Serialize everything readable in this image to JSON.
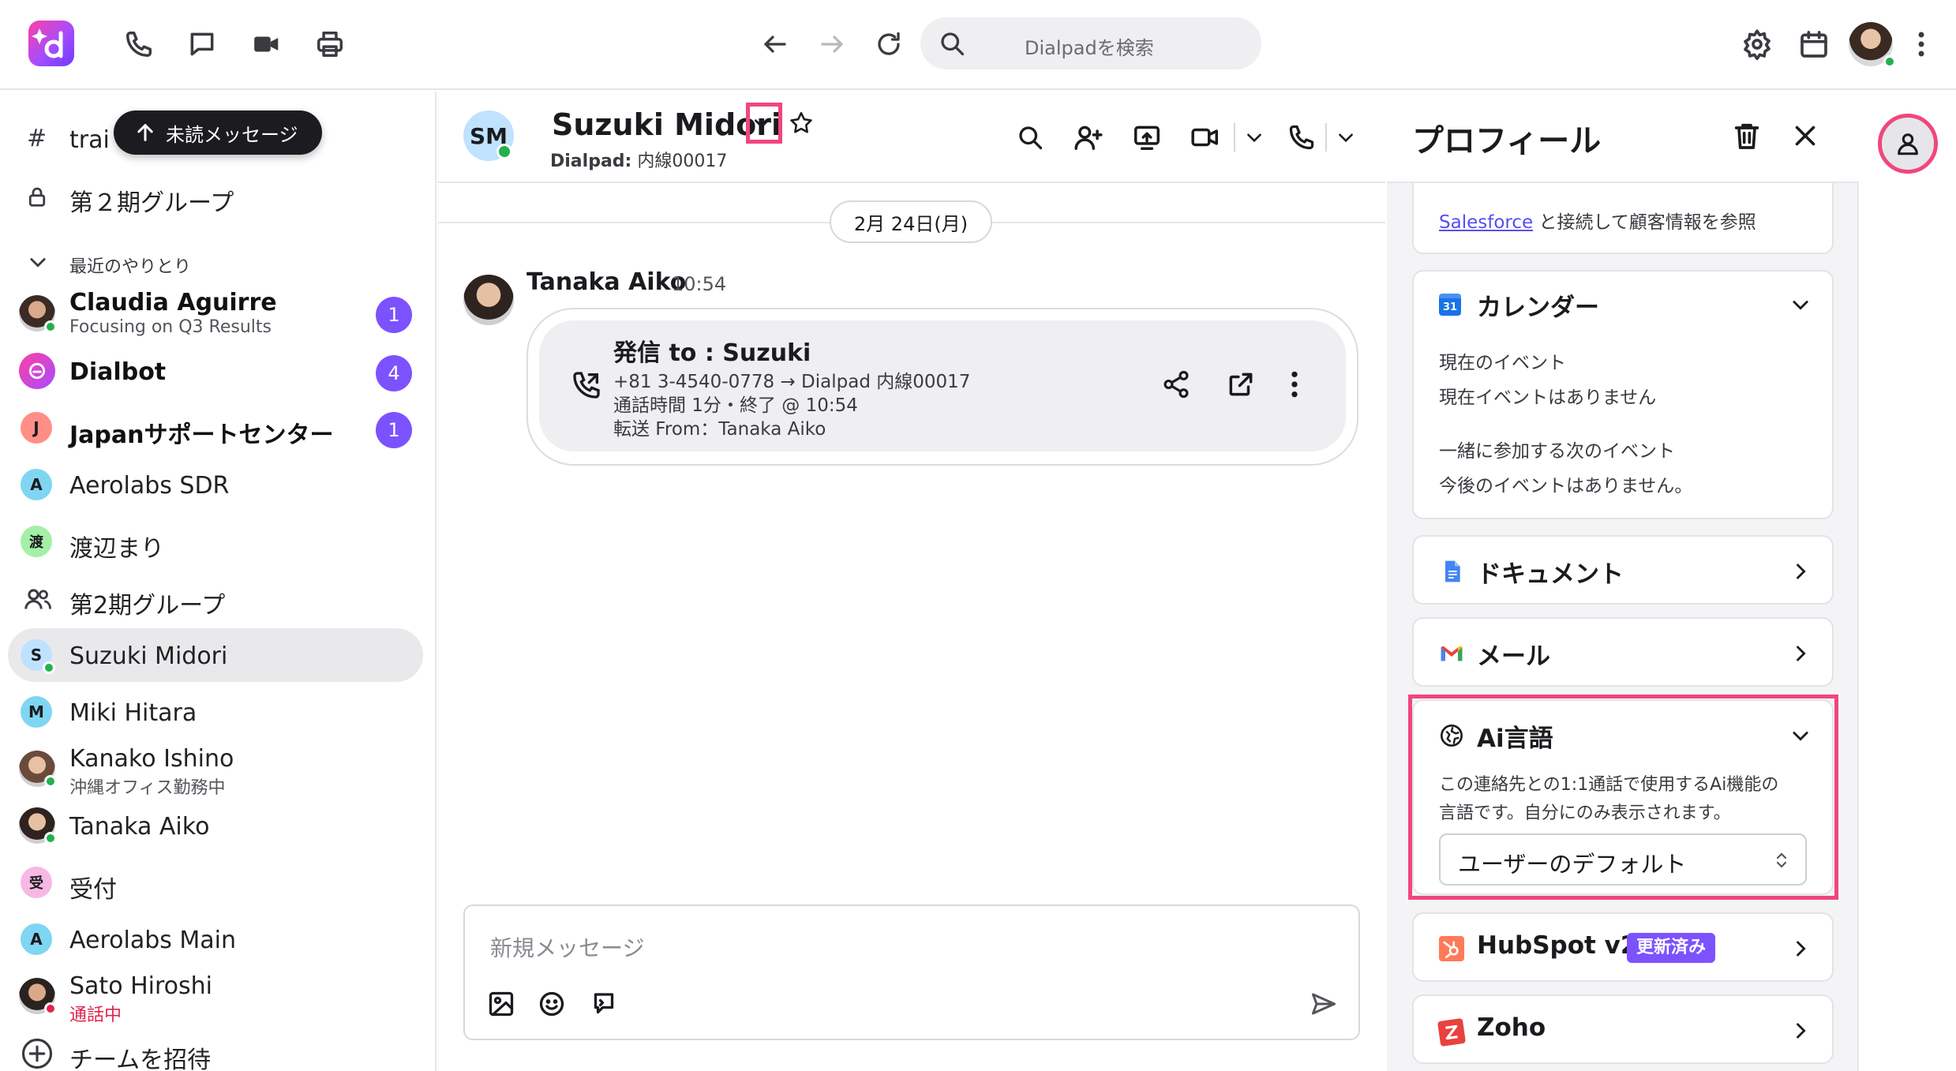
{
  "topbar": {
    "search_placeholder": "Dialpadを検索",
    "avatar_status": "online"
  },
  "sidebar": {
    "unread_pill": "未読メッセージ",
    "partial_row_1": "trai",
    "channel_1": "第２期グループ",
    "section_label": "最近のやりとり",
    "items": [
      {
        "name": "Claudia Aguirre",
        "sub": "Focusing on Q3 Results",
        "badge": "1",
        "bold": true
      },
      {
        "name": "Dialbot",
        "badge": "4",
        "bold": true
      },
      {
        "name": "Japanサポートセンター",
        "initial": "J",
        "badge": "1",
        "bold": true
      },
      {
        "name": "Aerolabs SDR",
        "initial": "A"
      },
      {
        "name": "渡辺まり",
        "initial": "渡"
      },
      {
        "name": "第2期グループ"
      },
      {
        "name": "Suzuki Midori",
        "initial": "S",
        "selected": true
      },
      {
        "name": "Miki Hitara",
        "initial": "M"
      },
      {
        "name": "Kanako Ishino",
        "sub": "沖縄オフィス勤務中"
      },
      {
        "name": "Tanaka Aiko"
      },
      {
        "name": "受付",
        "initial": "受"
      },
      {
        "name": "Aerolabs Main",
        "initial": "A"
      },
      {
        "name": "Sato Hiroshi",
        "sub": "通話中"
      },
      {
        "name": "チームを招待"
      }
    ]
  },
  "chat": {
    "contact_initials": "SM",
    "contact_name": "Suzuki Midori",
    "contact_sub_label": "Dialpad:",
    "contact_sub_value": "内線00017",
    "date_divider": "2月 24日(月)",
    "message": {
      "sender": "Tanaka Aiko",
      "time": "10:54",
      "call_title": "発信 to : Suzuki",
      "call_line1": "+81 3-4540-0778 → Dialpad 内線00017",
      "call_line2": "通話時間 1分・終了 @ 10:54",
      "call_line3": "転送 From：Tanaka Aiko"
    },
    "composer_placeholder": "新規メッセージ"
  },
  "profile": {
    "title": "プロフィール",
    "salesforce_link": "Salesforce",
    "salesforce_text": " と接続して顧客情報を参照",
    "calendar": {
      "title": "カレンダー",
      "icon_text": "31",
      "current_label": "現在のイベント",
      "current_value": "現在イベントはありません",
      "next_label": "一緒に参加する次のイベント",
      "next_value": "今後のイベントはありません。"
    },
    "documents_title": "ドキュメント",
    "mail_title": "メール",
    "ai_language": {
      "title": "Ai言語",
      "desc_line1": "この連絡先との1:1通話で使用するAi機能の",
      "desc_line2": "言語です。自分にのみ表示されます。",
      "selected": "ユーザーのデフォルト"
    },
    "hubspot": {
      "title": "HubSpot v2",
      "badge": "更新済み"
    },
    "zoho_title": "Zoho"
  },
  "colors": {
    "accent_purple": "#7c52ff",
    "highlight_pink": "#f0467e",
    "online_green": "#22b14c",
    "busy_red": "#e0244a"
  }
}
